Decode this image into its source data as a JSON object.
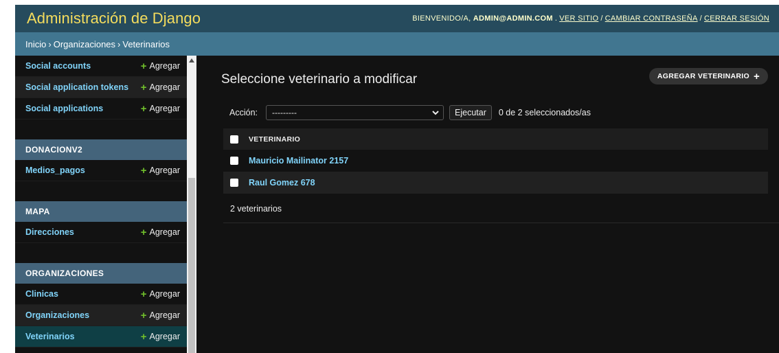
{
  "header": {
    "branding": "Administración de Django",
    "welcome": "BIENVENIDO/A,",
    "user": "ADMIN@ADMIN.COM",
    "view_site": "VER SITIO",
    "change_password": "CAMBIAR CONTRASEÑA",
    "logout": "CERRAR SESIÓN"
  },
  "breadcrumbs": [
    "Inicio",
    "Organizaciones",
    "Veterinarios"
  ],
  "sidebar": {
    "add_label": "Agregar",
    "top_items": [
      {
        "label": "Social accounts"
      },
      {
        "label": "Social application tokens"
      },
      {
        "label": "Social applications"
      }
    ],
    "modules": [
      {
        "caption": "DONACIONV2",
        "items": [
          {
            "label": "Medios_pagos"
          }
        ]
      },
      {
        "caption": "MAPA",
        "items": [
          {
            "label": "Direcciones"
          }
        ]
      },
      {
        "caption": "ORGANIZACIONES",
        "items": [
          {
            "label": "Clinicas"
          },
          {
            "label": "Organizaciones"
          },
          {
            "label": "Veterinarios"
          }
        ]
      }
    ]
  },
  "main": {
    "title": "Seleccione veterinario a modificar",
    "add_button": "AGREGAR VETERINARIO",
    "action_label": "Acción:",
    "action_value": "---------",
    "run_button": "Ejecutar",
    "selection_count": "0 de 2 seleccionados/as",
    "column_header": "VETERINARIO",
    "rows": [
      "Mauricio Mailinator 2157",
      "Raul Gomez 678"
    ],
    "paginator": "2 veterinarios"
  },
  "colors": {
    "header_bg": "#264b5d",
    "branding": "#f5dd5d",
    "breadcrumbs_bg": "#417690",
    "module_caption_bg": "#44647b",
    "link": "#81d4fa",
    "add_plus": "#70bf2b",
    "background": "#121212"
  },
  "icons": {
    "add": "plus-icon",
    "select": "chevron-down-icon",
    "scroll_up": "triangle-up-icon"
  }
}
